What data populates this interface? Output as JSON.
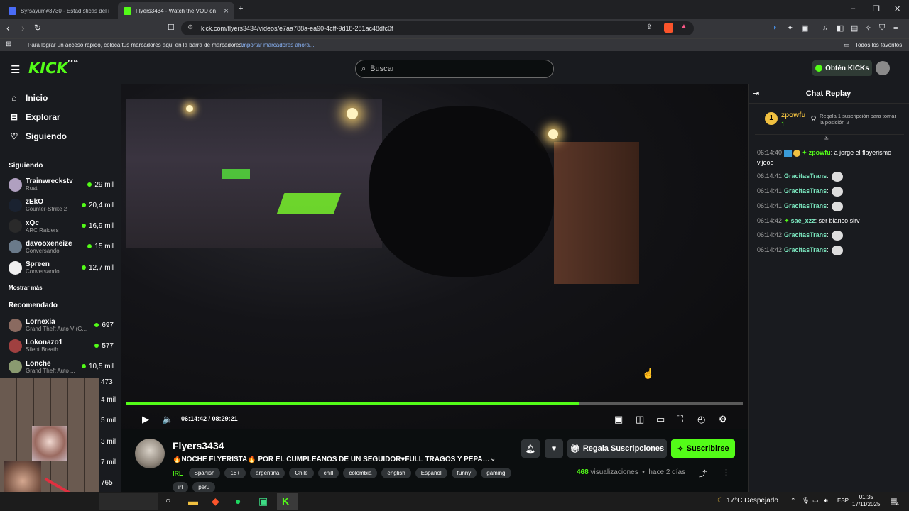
{
  "browser": {
    "tabs": [
      {
        "label": "Syrsayum#3730 - Estadísticas del inv",
        "active": false
      },
      {
        "label": "Flyers3434 - Watch the VOD on",
        "active": true
      }
    ],
    "url": "kick.com/flyers3434/videos/e7aa788a-ea90-4cff-9d18-281ac48dfc0f",
    "bookmarks_msg": "Para lograr un acceso rápido, coloca tus marcadores aquí en la barra de marcadores.",
    "bookmarks_link": "Importar marcadores ahora...",
    "all_favs": "Todos los favoritos"
  },
  "header": {
    "logo": "KICK",
    "logo_badge": "BETA",
    "search_placeholder": "Buscar",
    "kicks_label": "Obtén KICKs"
  },
  "sidebar": {
    "nav": [
      {
        "label": "Inicio",
        "icon": "home-icon"
      },
      {
        "label": "Explorar",
        "icon": "compass-icon"
      },
      {
        "label": "Siguiendo",
        "icon": "heart-icon"
      }
    ],
    "following_title": "Siguiendo",
    "following": [
      {
        "name": "Trainwreckstv",
        "cat": "Rust",
        "viewers": "29 mil",
        "color": "#b0a0c0"
      },
      {
        "name": "zEkO",
        "cat": "Counter-Strike 2",
        "viewers": "20,4 mil",
        "color": "#1a2230"
      },
      {
        "name": "xQc",
        "cat": "ARC Raiders",
        "viewers": "16,9 mil",
        "color": "#2a2a2a"
      },
      {
        "name": "davooxeneize",
        "cat": "Conversando",
        "viewers": "15 mil",
        "color": "#6a7a8a"
      },
      {
        "name": "Spreen",
        "cat": "Conversando",
        "viewers": "12,7 mil",
        "color": "#f0f0f0"
      }
    ],
    "show_more": "Mostrar más",
    "recommended_title": "Recomendado",
    "recommended": [
      {
        "name": "Lornexia",
        "cat": "Grand Theft Auto V (G...",
        "viewers": "697",
        "color": "#8a6a60"
      },
      {
        "name": "Lokonazo1",
        "cat": "Silent Breath",
        "viewers": "577",
        "color": "#a04040"
      },
      {
        "name": "Lonche",
        "cat": "Grand Theft Auto ...",
        "viewers": "10,5 mil",
        "color": "#8a9a70"
      }
    ],
    "partial_viewers": [
      "473",
      "4 mil",
      "5 mil",
      "3 mil",
      "7 mil",
      "765"
    ]
  },
  "player": {
    "time_current": "06:14:42",
    "time_total": "08:29:21",
    "progress": 0.735
  },
  "channel": {
    "name": "Flyers3434",
    "title": "🔥NOCHE FLYERISTA🔥 POR EL CUMPLEAÑOS DE UN SEGUIDOR♥FULL TRAGOS Y PEPAS EN C...",
    "category": "IRL",
    "tags": [
      "Spanish",
      "18+",
      "argentina",
      "Chile",
      "chill",
      "colombia",
      "english",
      "Español",
      "funny",
      "gaming",
      "irl",
      "peru"
    ],
    "gift_label": "Regala Suscripciones",
    "subscribe_label": "Suscribirse",
    "views_count": "468",
    "views_label": "visualizaciones",
    "ago": "hace 2 días"
  },
  "chat": {
    "title": "Chat Replay",
    "pinned": {
      "user": "zpowfu",
      "rank": "1",
      "count": "1",
      "note": "Regala 1 suscripción para tomar la posición 2"
    },
    "messages": [
      {
        "ts": "06:14:40",
        "user": "zpowfu",
        "color": "#53fc18",
        "text": "a jorge el flayerismo vijeoo",
        "emote": false
      },
      {
        "ts": "06:14:41",
        "user": "GracitasTrans",
        "color": "#7ce8c0",
        "text": "",
        "emote": true
      },
      {
        "ts": "06:14:41",
        "user": "GracitasTrans",
        "color": "#7ce8c0",
        "text": "",
        "emote": true
      },
      {
        "ts": "06:14:41",
        "user": "GracitasTrans",
        "color": "#7ce8c0",
        "text": "",
        "emote": true
      },
      {
        "ts": "06:14:42",
        "user": "sae_xzz",
        "color": "#7ce8c0",
        "text": "ser blanco sirv",
        "emote": false
      },
      {
        "ts": "06:14:42",
        "user": "GracitasTrans",
        "color": "#7ce8c0",
        "text": "",
        "emote": true
      },
      {
        "ts": "06:14:42",
        "user": "GracitasTrans",
        "color": "#7ce8c0",
        "text": "",
        "emote": true
      }
    ]
  },
  "taskbar": {
    "weather": "17°C  Despejado",
    "lang": "ESP",
    "time": "01:35",
    "date": "17/11/2025",
    "notif": "4"
  }
}
